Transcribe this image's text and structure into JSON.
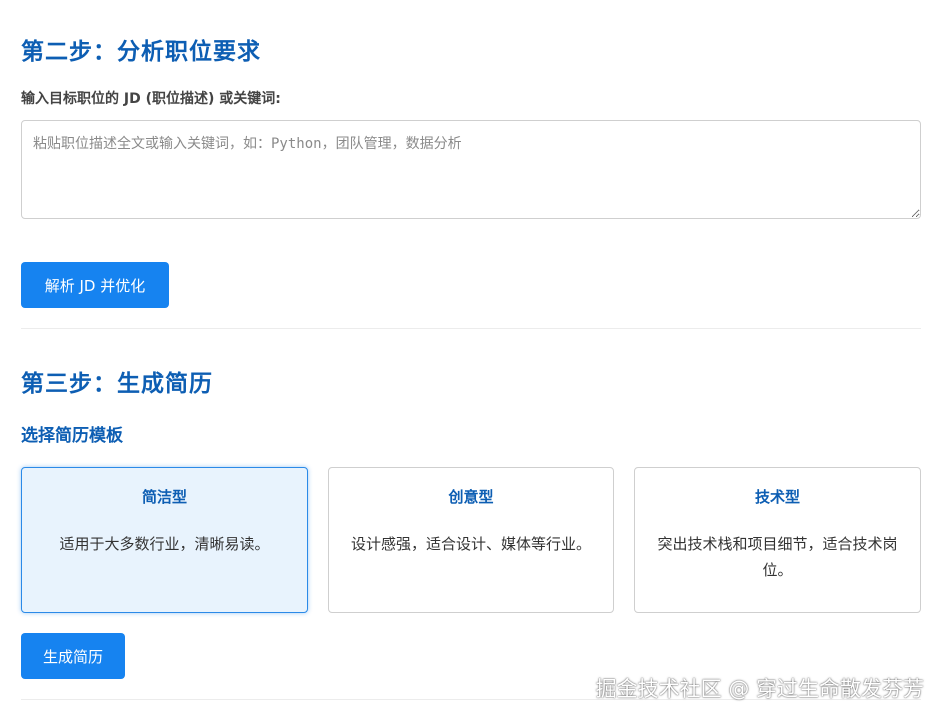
{
  "step2": {
    "title": "第二步：分析职位要求",
    "field_label": "输入目标职位的 JD (职位描述) 或关键词:",
    "textarea_value": "",
    "textarea_placeholder": "粘贴职位描述全文或输入关键词，如：Python，团队管理，数据分析",
    "parse_button_label": "解析 JD 并优化"
  },
  "step3": {
    "title": "第三步：生成简历",
    "template_heading": "选择简历模板",
    "templates": [
      {
        "name": "简洁型",
        "description": "适用于大多数行业，清晰易读。",
        "selected": true
      },
      {
        "name": "创意型",
        "description": "设计感强，适合设计、媒体等行业。",
        "selected": false
      },
      {
        "name": "技术型",
        "description": "突出技术栈和项目细节，适合技术岗位。",
        "selected": false
      }
    ],
    "generate_button_label": "生成简历"
  },
  "watermark": "掘金技术社区 @ 穿过生命散发芬芳",
  "colors": {
    "heading": "#0d5eb3",
    "button": "#1683f0",
    "selected_card_bg": "#e8f3fd",
    "selected_card_border": "#2b8ae8"
  }
}
